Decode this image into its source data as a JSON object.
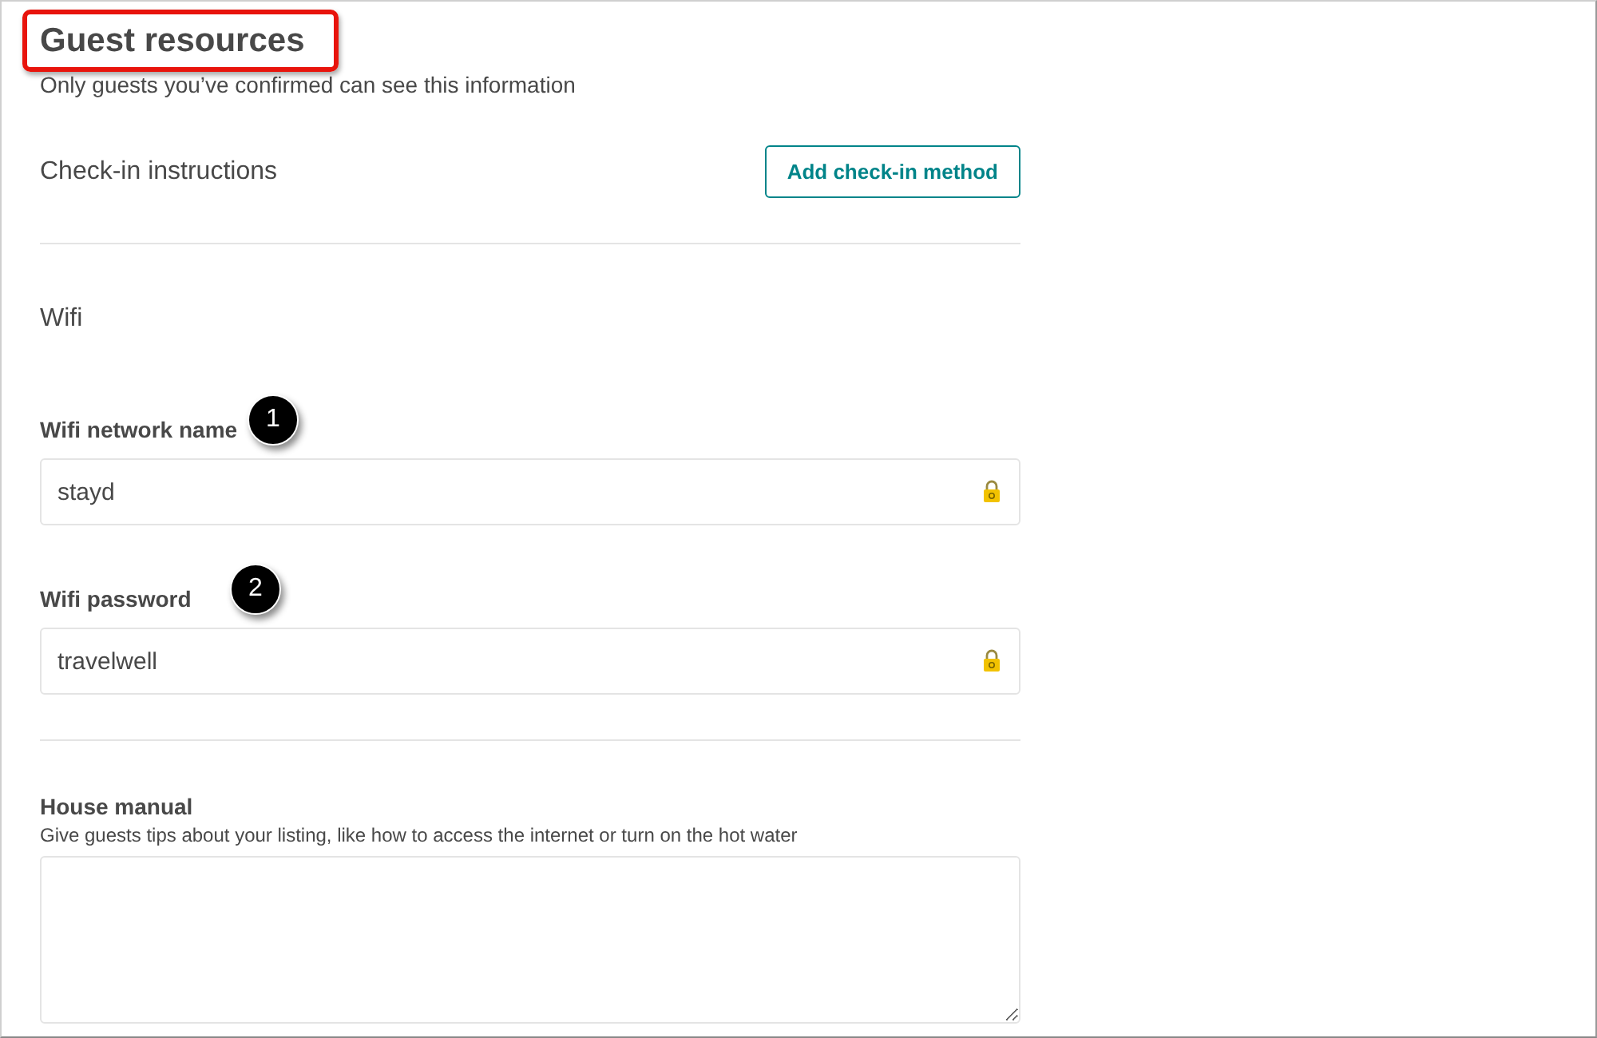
{
  "title": "Guest resources",
  "subtitle": "Only guests you’ve confirmed can see this information",
  "checkin": {
    "heading": "Check-in instructions",
    "button": "Add check-in method"
  },
  "wifi": {
    "heading": "Wifi",
    "fields": [
      {
        "label": "Wifi network name",
        "value": "stayd",
        "locked": true,
        "callout": "1"
      },
      {
        "label": "Wifi password",
        "value": "travelwell",
        "locked": true,
        "callout": "2"
      }
    ]
  },
  "house_manual": {
    "label": "House manual",
    "hint": "Give guests tips about your listing, like how to access the internet or turn on the hot water"
  }
}
